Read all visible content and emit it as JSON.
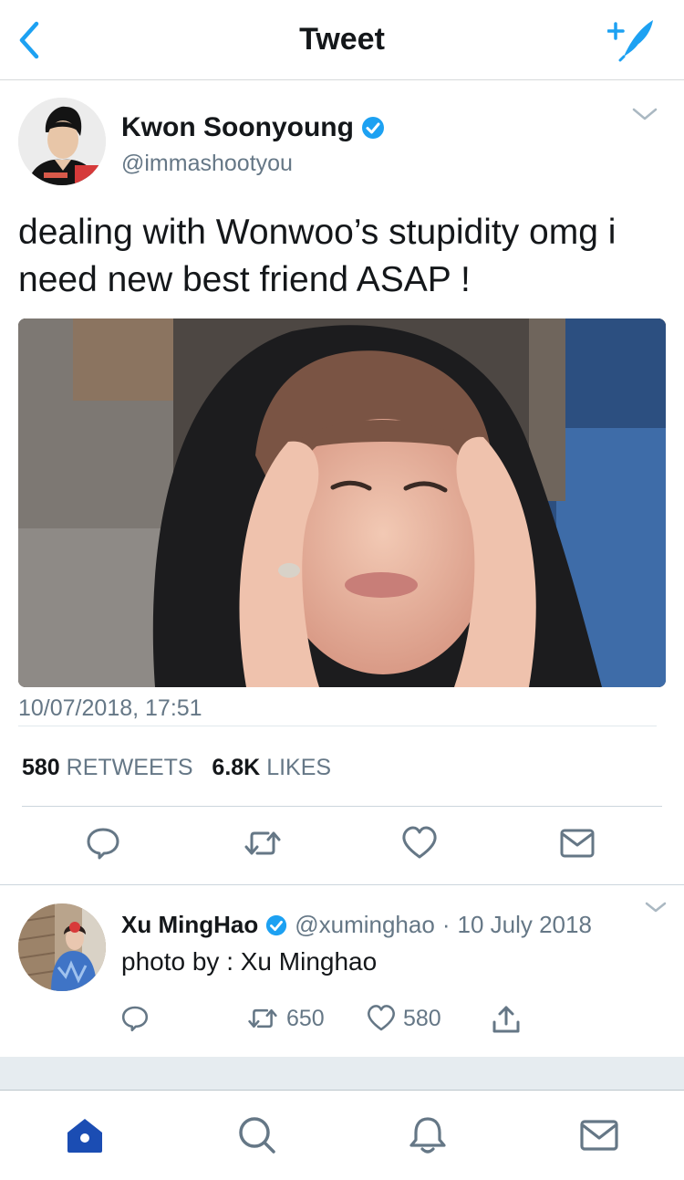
{
  "header": {
    "title": "Tweet"
  },
  "main_tweet": {
    "author_name": "Kwon Soonyoung",
    "author_handle": "@immashootyou",
    "text": "dealing with Wonwoo’s stupidity omg i need new best friend ASAP !",
    "timestamp": "10/07/2018, 17:51",
    "retweets_count": "580",
    "retweets_label": "RETWEETS",
    "likes_count": "6.8K",
    "likes_label": "LIKES"
  },
  "reply": {
    "author_name": "Xu MingHao",
    "author_handle": "@xuminghao",
    "separator": "·",
    "date": "10 July 2018",
    "text": "photo by : Xu Minghao",
    "retweets_count": "650",
    "likes_count": "580"
  },
  "colors": {
    "accent": "#1da1f2",
    "text": "#14171a",
    "secondary": "#657786",
    "active_tab": "#1b4db3"
  },
  "icons": {
    "back": "chevron-left-icon",
    "compose": "compose-feather-icon",
    "verified": "verified-badge-icon",
    "reply": "reply-icon",
    "retweet": "retweet-icon",
    "like": "heart-icon",
    "dm": "envelope-icon",
    "share": "share-icon",
    "home": "home-icon",
    "search": "search-icon",
    "notifications": "bell-icon",
    "messages": "envelope-icon"
  }
}
